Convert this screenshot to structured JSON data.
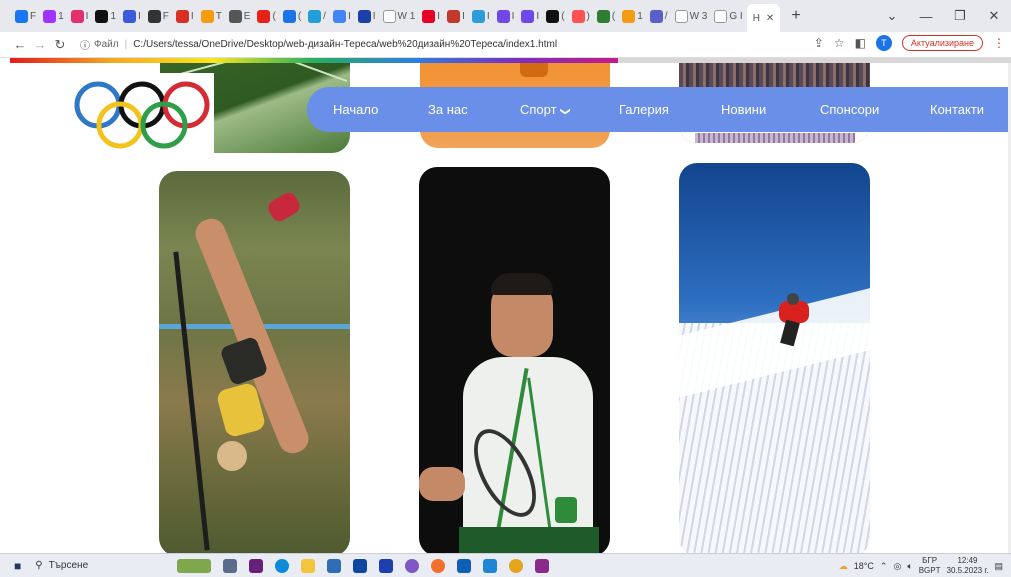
{
  "browser": {
    "tabs": [
      {
        "icon": "facebook-icon",
        "color": "#1877f2",
        "label": "F"
      },
      {
        "icon": "messenger-icon",
        "color": "#a033ff",
        "label": "1"
      },
      {
        "icon": "instagram-icon",
        "color": "#e1306c",
        "label": "I"
      },
      {
        "icon": "tiktok-icon",
        "color": "#111111",
        "label": "1"
      },
      {
        "icon": "vpn-icon",
        "color": "#3b5bdb",
        "label": "I"
      },
      {
        "icon": "github-icon",
        "color": "#333333",
        "label": "F"
      },
      {
        "icon": "gmail-icon",
        "color": "#d93025",
        "label": "I"
      },
      {
        "icon": "orange-app-icon",
        "color": "#f39c12",
        "label": "T"
      },
      {
        "icon": "settings-app-icon",
        "color": "#555555",
        "label": "E"
      },
      {
        "icon": "youtube-icon",
        "color": "#e62117",
        "label": "("
      },
      {
        "icon": "chat-icon",
        "color": "#1a73e8",
        "label": "("
      },
      {
        "icon": "telegram-icon",
        "color": "#229ed9",
        "label": "/"
      },
      {
        "icon": "docs-icon",
        "color": "#4285f4",
        "label": "I"
      },
      {
        "icon": "flag-icon",
        "color": "#1c3faa",
        "label": "I"
      },
      {
        "icon": "wiki-icon",
        "color": "#ffffff",
        "label": "W 1"
      },
      {
        "icon": "pinterest-icon",
        "color": "#e60023",
        "label": "I"
      },
      {
        "icon": "red-app-icon",
        "color": "#c0392b",
        "label": "I"
      },
      {
        "icon": "mail-icon",
        "color": "#2d9cdb",
        "label": "I"
      },
      {
        "icon": "bookmark-icon",
        "color": "#7048e8",
        "label": "I"
      },
      {
        "icon": "forms-icon",
        "color": "#7048e8",
        "label": "I"
      },
      {
        "icon": "black-app-icon",
        "color": "#111111",
        "label": "("
      },
      {
        "icon": "circle-app-icon",
        "color": "#ff5252",
        "label": ")"
      },
      {
        "icon": "green-app-icon",
        "color": "#2e7d32",
        "label": "("
      },
      {
        "icon": "orange-dot-icon",
        "color": "#f39c12",
        "label": "1"
      },
      {
        "icon": "teams-icon",
        "color": "#5b5fc7",
        "label": "/"
      },
      {
        "icon": "wiki2-icon",
        "color": "#ffffff",
        "label": "W 3"
      },
      {
        "icon": "google-icon",
        "color": "#ffffff",
        "label": "G I"
      }
    ],
    "active_tab_label": "H",
    "url_scheme": "Файл",
    "url": "C:/Users/tessa/OneDrive/Desktop/web-дизайн-Тереса/web%20дизайн%20Тереса/index1.html",
    "profile_initial": "T",
    "update_label": "Актуализиране"
  },
  "site": {
    "menu": [
      {
        "label": "Начало",
        "name": "menu-home"
      },
      {
        "label": "За нас",
        "name": "menu-about"
      },
      {
        "label": "Спорт",
        "name": "menu-sport"
      },
      {
        "label": "Галерия",
        "name": "menu-gallery"
      },
      {
        "label": "Новини",
        "name": "menu-news"
      },
      {
        "label": "Спонсори",
        "name": "menu-sponsors"
      },
      {
        "label": "Контакти",
        "name": "menu-contacts"
      }
    ],
    "sport_chevron_icon": "chevron-down-icon",
    "gallery_images": [
      "pole-vault-photo",
      "tennis-player-photo",
      "skier-photo"
    ]
  },
  "taskbar": {
    "search_placeholder": "Търсене",
    "weather": "18°C",
    "lang_top": "БГР",
    "lang_bottom": "BGPT",
    "time": "12:49",
    "date": "30.5.2023 г."
  }
}
